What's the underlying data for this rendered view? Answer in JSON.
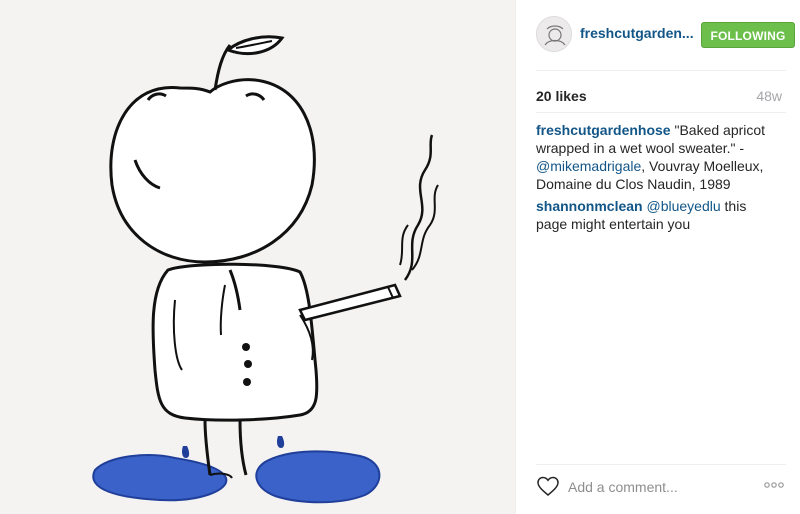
{
  "post": {
    "image_description_icon": "apricot-character-drawing",
    "author": {
      "username": "freshcutgarden...",
      "avatar_icon": "avatar-icon"
    },
    "follow_label": "FOLLOWING",
    "likes_label": "20 likes",
    "age_label": "48w",
    "comments": [
      {
        "user": "freshcutgardenhose",
        "text_before": " \"Baked apricot wrapped in a wet wool sweater.\" - ",
        "mention": "@mikemadrigale",
        "text_after": ", Vouvray Moelleux, Domaine du Clos Naudin, 1989"
      },
      {
        "user": "shannonmclean",
        "text_before": " ",
        "mention": "@blueyedlu",
        "text_after": " this page might entertain you"
      }
    ],
    "comment_placeholder": "Add a comment...",
    "more_label": "ooo"
  },
  "colors": {
    "link": "#125688",
    "follow_green": "#6bbf4a",
    "puddle_blue": "#3a62c8"
  }
}
